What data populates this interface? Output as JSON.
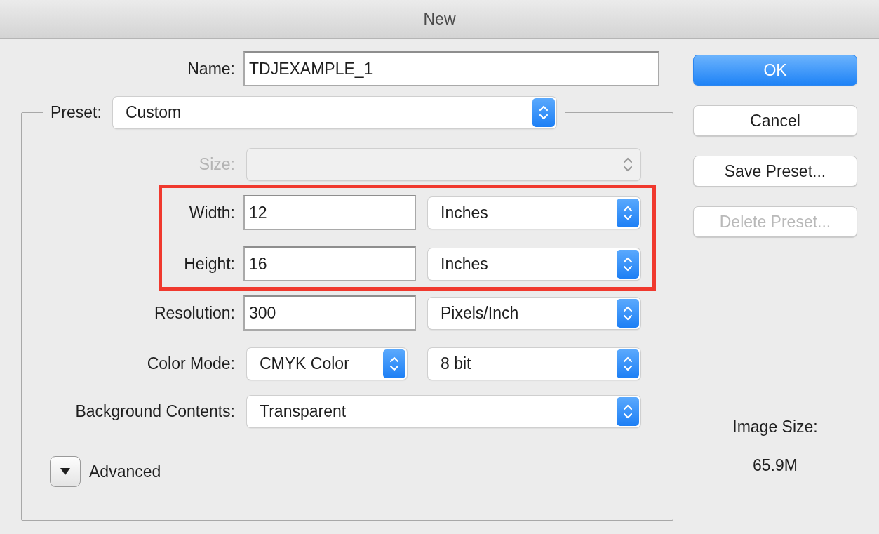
{
  "window": {
    "title": "New"
  },
  "name_field": {
    "label": "Name:",
    "value": "TDJEXAMPLE_1"
  },
  "preset": {
    "label": "Preset:",
    "value": "Custom"
  },
  "size": {
    "label": "Size:",
    "disabled": true
  },
  "dimensions": {
    "highlighted": true,
    "rows": [
      {
        "label": "Width:",
        "value": "12",
        "unit": "Inches"
      },
      {
        "label": "Height:",
        "value": "16",
        "unit": "Inches"
      }
    ]
  },
  "resolution": {
    "label": "Resolution:",
    "value": "300",
    "unit": "Pixels/Inch"
  },
  "color_mode": {
    "label": "Color Mode:",
    "mode": "CMYK Color",
    "depth": "8 bit"
  },
  "background_contents": {
    "label": "Background Contents:",
    "value": "Transparent"
  },
  "advanced": {
    "label": "Advanced",
    "expanded": false
  },
  "buttons": [
    {
      "label": "OK",
      "default": true,
      "disabled": false
    },
    {
      "label": "Cancel",
      "default": false,
      "disabled": false
    },
    {
      "label": "Save Preset...",
      "default": false,
      "disabled": false
    },
    {
      "label": "Delete Preset...",
      "default": false,
      "disabled": true
    }
  ],
  "image_size": {
    "label": "Image Size:",
    "value": "65.9M"
  }
}
